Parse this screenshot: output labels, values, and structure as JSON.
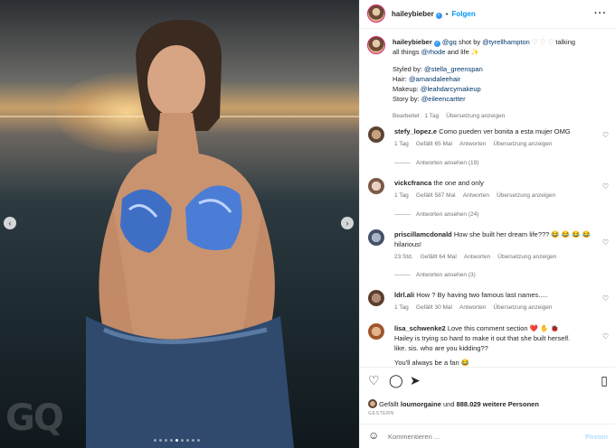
{
  "post": {
    "username": "haileybieber",
    "follow_label": "Folgen",
    "more_icon": "more-icon",
    "watermark": "GQ"
  },
  "caption": {
    "username": "haileybieber",
    "mention_gq": "@gq",
    "shot_by": "shot by",
    "mention_photographer": "@tyrellhampton",
    "hearts": "♡ ♡ ♡",
    "talking": "talking",
    "line2_prefix": "all things",
    "mention_rhode": "@rhode",
    "line2_suffix": "and life ✨",
    "styled_label": "Styled by:",
    "styled_by": "@stella_greenspan",
    "hair_label": "Hair:",
    "hair_by": "@amandaleehair",
    "makeup_label": "Makeup:",
    "makeup_by": "@leahdarcymakeup",
    "story_label": "Story by:",
    "story_by": "@eileencartter",
    "edited": "Bearbeitet · 1 Tag",
    "translate": "Übersetzung anzeigen"
  },
  "comments": [
    {
      "user": "stefy_lopez.e",
      "text": "Como pueden ver bonita a esta mujer OMG",
      "time": "1 Tag",
      "likes": "Gefällt 65 Mal",
      "reply": "Antworten",
      "translate": "Übersetzung anzeigen",
      "view_replies": "Antworten ansehen (19)"
    },
    {
      "user": "vickcfranca",
      "text": "the one and only",
      "time": "1 Tag",
      "likes": "Gefällt 587 Mal",
      "reply": "Antworten",
      "translate": "Übersetzung anzeigen",
      "view_replies": "Antworten ansehen (24)"
    },
    {
      "user": "priscillamcdonald",
      "text": "How she built her dream life??? 😂 😂 😂 😂",
      "text2": "hilarious!",
      "time": "23 Std.",
      "likes": "Gefällt 64 Mal",
      "reply": "Antworten",
      "translate": "Übersetzung anzeigen",
      "view_replies": "Antworten ansehen (3)"
    },
    {
      "user": "ldrl.ali",
      "text": "How ? By having two famous last names.....",
      "time": "1 Tag",
      "likes": "Gefällt 30 Mal",
      "reply": "Antworten",
      "translate": "Übersetzung anzeigen"
    },
    {
      "user": "lisa_schwenke2",
      "text": "Love this comment section ❤️ ✋ 🐞",
      "text2": "Hailey is trying so hard to make it out that she built herself.",
      "text3": "like. sis. who are you kidding??",
      "text4": "You'll always be a fan 😂"
    }
  ],
  "actions": {
    "liked_by_prefix": "Gefällt",
    "liked_by_user": "loumorgaine",
    "liked_by_conj": "und",
    "liked_by_count": "888.029 weitere Personen",
    "date": "GESTERN"
  },
  "composer": {
    "placeholder": "Kommentieren ...",
    "post_label": "Posten"
  }
}
